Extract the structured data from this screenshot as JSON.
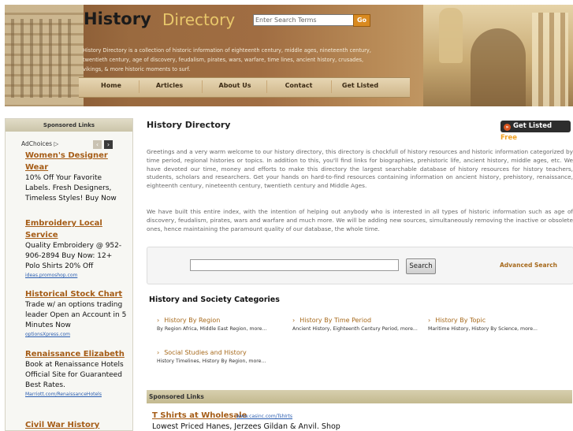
{
  "header": {
    "title": "History",
    "subtitle": "Directory",
    "search_placeholder": "Enter Search Terms",
    "go_label": "Go",
    "intro": "History Directory is a collection of historic information of eighteenth century, middle ages, nineteenth century, twentieth century, age of discovery, feudalism, pirates, wars, warfare, time lines, ancient history, crusades, vikings, & more historic moments to surf."
  },
  "nav": {
    "items": [
      {
        "label": "Home"
      },
      {
        "label": "Articles"
      },
      {
        "label": "About Us"
      },
      {
        "label": "Contact"
      },
      {
        "label": "Get Listed"
      }
    ]
  },
  "sidebar": {
    "heading": "Sponsored Links",
    "adchoices": "AdChoices ▷",
    "ads": [
      {
        "title": "Women's Designer Wear",
        "body": "10% Off Your Favorite Labels. Fresh Designers, Timeless Styles! Buy Now",
        "url": ""
      },
      {
        "title": "Embroidery Local Service",
        "body": "Quality Embroidery @ 952-906-2894 Buy Now: 12+ Polo Shirts 20% Off",
        "url": "ideas.promoshop.com"
      },
      {
        "title": "Historical Stock Chart",
        "body": "Trade w/ an options trading leader Open an Account in 5 Minutes Now",
        "url": "optionsXpress.com"
      },
      {
        "title": "Renaissance Elizabeth",
        "body": "Book at Renaissance Hotels Official Site for Guaranteed Best Rates.",
        "url": "Marriott.com/RenaissanceHotels"
      },
      {
        "title": "Civil War History",
        "body": "",
        "url": ""
      }
    ]
  },
  "main": {
    "title": "History Directory",
    "get_listed": {
      "label": "Get Listed",
      "free": "Free"
    },
    "paragraphs": [
      "Greetings and a very warm welcome to our history directory, this directory is chockfull of history resources and historic information categorized by time period, regional histories or topics. In addition to this, you'll find links for biographies, prehistoric life, ancient history, middle ages, etc. We have devoted our time, money and efforts to make this directory the largest searchable database of history resources for history teachers, students, scholars and researchers. Get your hands on hard-to-find resources containing information on ancient history, prehistory, renaissance, eighteenth century, nineteenth century, twentieth century and Middle Ages.",
      "We have built this entire index, with the intention of helping out anybody who is interested in all types of historic information such as age of discovery, feudalism, pirates, wars and warfare and much more. We will be adding new sources, simultaneously removing the inactive or obsolete ones, hence maintaining the paramount quality of our database, the whole time."
    ],
    "search": {
      "button": "Search",
      "advanced": "Advanced Search",
      "value": ""
    },
    "categories_title": "History and Society Categories",
    "categories": [
      {
        "label": "History By Region",
        "sub": "By Region Africa, Middle East Region, more..."
      },
      {
        "label": "History By Time Period",
        "sub": "Ancient History, Eighteenth Century Period, more..."
      },
      {
        "label": "History By Topic",
        "sub": "Maritime History, History By Science, more..."
      },
      {
        "label": "Social Studies and History",
        "sub": "History Timelines, History By Region, more..."
      }
    ],
    "sponsored": {
      "heading": "Sponsored Links",
      "ad_title": "T Shirts at Wholesale",
      "ad_url": "www.casinc.com/TshIrts",
      "ad_body": "Lowest Priced Hanes, Jerzees Gildan & Anvil. Shop"
    }
  },
  "colors": {
    "link": "#a55c16",
    "accent": "#d98a20",
    "url": "#2a5db0"
  }
}
